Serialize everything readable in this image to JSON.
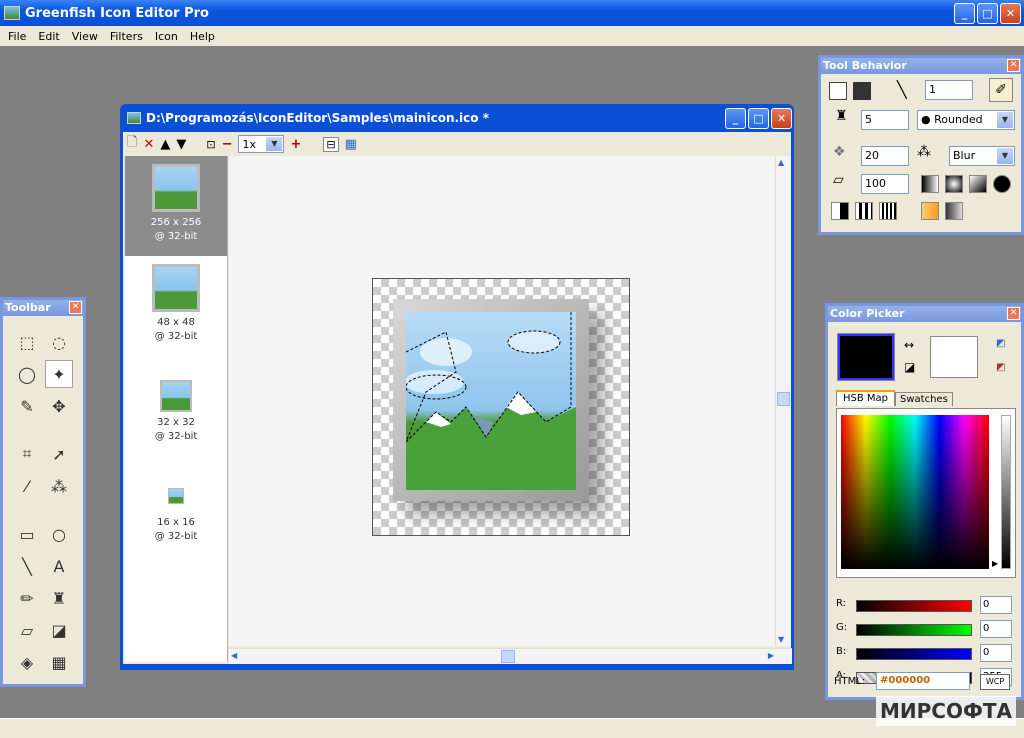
{
  "app": {
    "title": "Greenfish Icon Editor Pro"
  },
  "menu": [
    "File",
    "Edit",
    "View",
    "Filters",
    "Icon",
    "Help"
  ],
  "doc": {
    "title": "D:\\Programozás\\IconEditor\\Samples\\mainicon.ico *",
    "zoom": "1x",
    "sizes": [
      {
        "size": "256 x 256",
        "depth": "@ 32-bit"
      },
      {
        "size": "48 x 48",
        "depth": "@ 32-bit"
      },
      {
        "size": "32 x 32",
        "depth": "@ 32-bit"
      },
      {
        "size": "16 x 16",
        "depth": "@ 32-bit"
      }
    ]
  },
  "toolbar": {
    "title": "Toolbar"
  },
  "toolbehavior": {
    "title": "Tool Behavior",
    "line_width": "1",
    "brush_size": "5",
    "shape": "Rounded",
    "strength": "20",
    "effect": "Blur",
    "opacity": "100"
  },
  "colorpicker": {
    "title": "Color Picker",
    "tabs": [
      "HSB Map",
      "Swatches"
    ],
    "r_label": "R:",
    "r": "0",
    "g_label": "G:",
    "g": "0",
    "b_label": "B:",
    "b": "0",
    "a_label": "A:",
    "a": "255",
    "html_label": "HTML:",
    "html": "#000000",
    "wcp": "WCP"
  },
  "watermark": "МИРСОФТА"
}
